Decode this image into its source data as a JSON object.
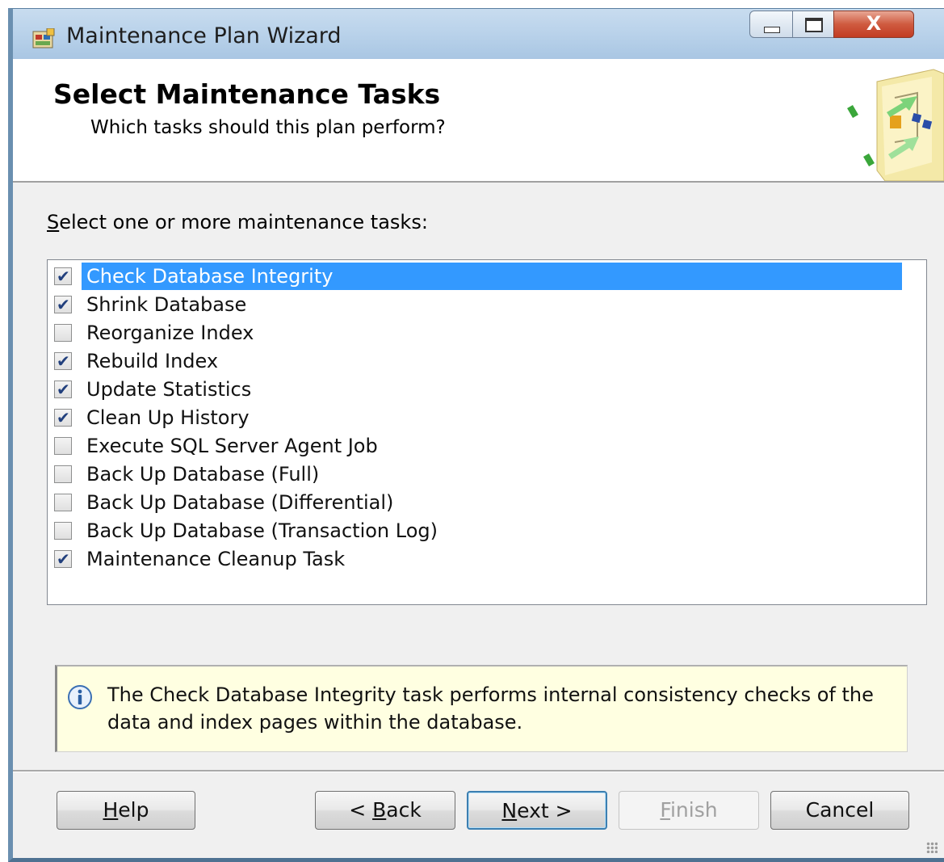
{
  "window": {
    "title": "Maintenance Plan Wizard",
    "close_glyph": "X"
  },
  "header": {
    "title": "Select Maintenance Tasks",
    "subtitle": "Which tasks should this plan perform?"
  },
  "tasks_label": {
    "accel": "S",
    "rest": "elect one or more maintenance tasks:"
  },
  "tasks": [
    {
      "label": "Check Database Integrity",
      "checked": true,
      "selected": true
    },
    {
      "label": "Shrink Database",
      "checked": true,
      "selected": false
    },
    {
      "label": "Reorganize Index",
      "checked": false,
      "selected": false
    },
    {
      "label": "Rebuild Index",
      "checked": true,
      "selected": false
    },
    {
      "label": "Update Statistics",
      "checked": true,
      "selected": false
    },
    {
      "label": "Clean Up History",
      "checked": true,
      "selected": false
    },
    {
      "label": "Execute SQL Server Agent Job",
      "checked": false,
      "selected": false
    },
    {
      "label": "Back Up Database (Full)",
      "checked": false,
      "selected": false
    },
    {
      "label": "Back Up Database (Differential)",
      "checked": false,
      "selected": false
    },
    {
      "label": "Back Up Database (Transaction Log)",
      "checked": false,
      "selected": false
    },
    {
      "label": "Maintenance Cleanup Task",
      "checked": true,
      "selected": false
    }
  ],
  "info": {
    "text": "The Check Database Integrity task performs internal consistency checks of the data and index pages within the database."
  },
  "buttons": {
    "help": {
      "accel": "H",
      "rest": "elp"
    },
    "back": {
      "pre": "< ",
      "accel": "B",
      "rest": "ack"
    },
    "next": {
      "accel": "N",
      "rest": "ext >"
    },
    "finish": {
      "accel": "F",
      "rest": "inish"
    },
    "cancel": "Cancel"
  },
  "colors": {
    "selection": "#3399ff",
    "info_background": "#ffffe1"
  },
  "icons": {
    "app": "maintenance-plan-icon",
    "header_art": "wizard-flowchart-art",
    "info": "info-icon",
    "checkmark": "checkmark-icon"
  }
}
